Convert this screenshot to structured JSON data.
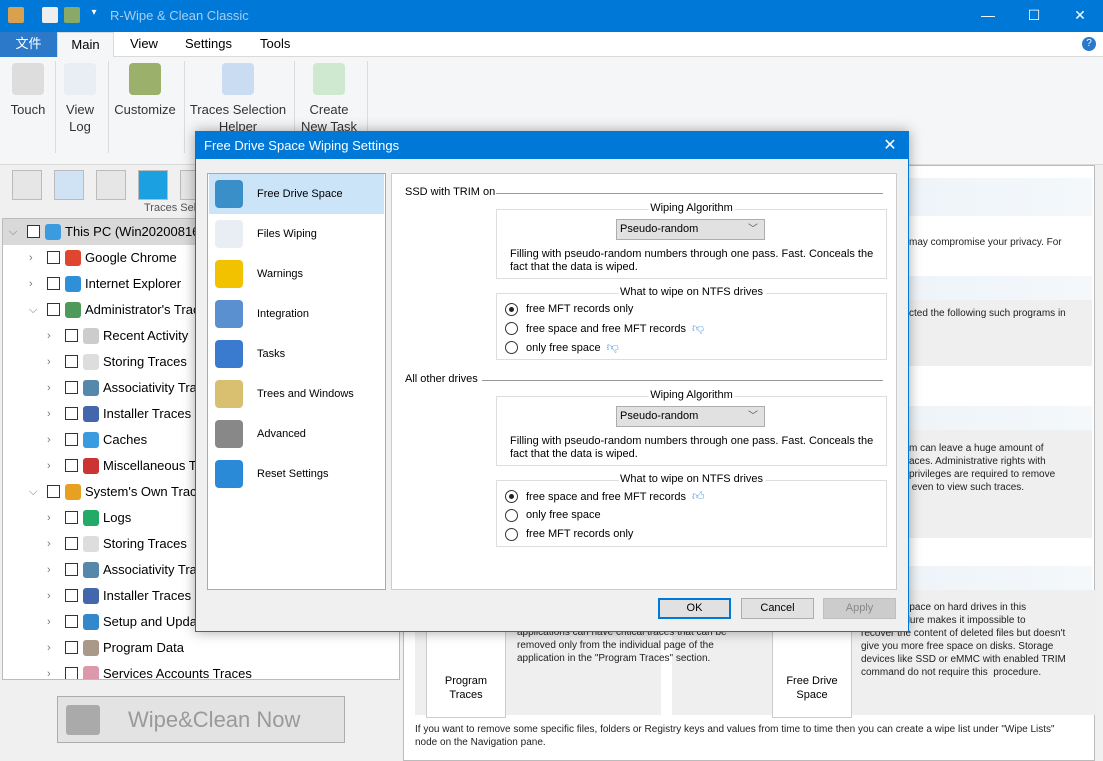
{
  "app": {
    "title": "R-Wipe & Clean Classic",
    "window_controls": [
      "minimize",
      "maximize",
      "close"
    ]
  },
  "menu": {
    "tabs": [
      "文件",
      "Main",
      "View",
      "Settings",
      "Tools"
    ],
    "active": "Main"
  },
  "ribbon": {
    "buttons": [
      {
        "label": "Touch",
        "icon": "touch-icon"
      },
      {
        "label": "View Log",
        "icon": "log-icon"
      },
      {
        "label": "Customize",
        "icon": "tools-icon"
      },
      {
        "label": "Traces Selection Helper",
        "icon": "wand-checklist-icon"
      },
      {
        "label": "Create New Task",
        "icon": "clipboard-add-icon"
      }
    ]
  },
  "toolbar": {
    "group_label": "Traces Sel"
  },
  "tree": [
    {
      "label": "This PC  (Win20200816",
      "level": 0,
      "expanded": true,
      "color": "#3a9be0"
    },
    {
      "label": "Google Chrome",
      "level": 1,
      "color": "#e0452f"
    },
    {
      "label": "Internet  Explorer",
      "level": 1,
      "color": "#2f8fd8"
    },
    {
      "label": "Administrator's Traces",
      "level": 1,
      "expanded": true,
      "color": "#4f9a5a"
    },
    {
      "label": "Recent Activity",
      "level": 2,
      "color": "#ccc"
    },
    {
      "label": "Storing Traces",
      "level": 2,
      "color": "#ddd"
    },
    {
      "label": "Associativity Traces",
      "level": 2,
      "color": "#58a"
    },
    {
      "label": "Installer Traces",
      "level": 2,
      "color": "#46a"
    },
    {
      "label": "Caches",
      "level": 2,
      "color": "#3a9be0"
    },
    {
      "label": "Miscellaneous Traces",
      "level": 2,
      "color": "#c33"
    },
    {
      "label": "System's Own Traces",
      "level": 1,
      "expanded": true,
      "color": "#e8a020"
    },
    {
      "label": "Logs",
      "level": 2,
      "color": "#2a6"
    },
    {
      "label": "Storing Traces",
      "level": 2,
      "color": "#ddd"
    },
    {
      "label": "Associativity Traces",
      "level": 2,
      "color": "#58a"
    },
    {
      "label": "Installer Traces",
      "level": 2,
      "color": "#46a"
    },
    {
      "label": "Setup and Updates",
      "level": 2,
      "color": "#38c"
    },
    {
      "label": "Program Data",
      "level": 2,
      "color": "#a98"
    },
    {
      "label": "Services Accounts Traces",
      "level": 2,
      "color": "#d9a"
    }
  ],
  "wipe_button": "Wipe&Clean Now",
  "main": {
    "s1_text": "may compromise your privacy. For",
    "s2_text": "cted the following such programs in",
    "s3_text": "m can leave a huge amount of\naces. Administrative rights with\nprivileges are required to remove\n even to view such traces.",
    "tile_program": "Program Traces",
    "program_text": "applications can have critical traces that can be removed only from the individual page of the application in the \"Program Traces\" section.",
    "tile_free": "Free Drive Space",
    "free_text": "wipe free space on hard drives in this\nthis procedure makes it impossible to\nrecover the content of deleted files but doesn't\ngive you more free space on disks. Storage\ndevices like SSD or eMMC with enabled TRIM\ncommand do not require this  procedure.",
    "footer": "If you want to remove some specific files, folders or Registry keys and values from time to time then you can create a wipe list under \"Wipe Lists\" node on the Navigation pane."
  },
  "dialog": {
    "title": "Free Drive Space Wiping Settings",
    "nav": [
      {
        "label": "Free Drive Space",
        "icon": "drive-icon",
        "color": "#3a8fc8",
        "selected": true
      },
      {
        "label": "Files Wiping",
        "icon": "file-icon",
        "color": "#e8eef4"
      },
      {
        "label": "Warnings",
        "icon": "warning-icon",
        "color": "#f2c200"
      },
      {
        "label": "Integration",
        "icon": "integration-icon",
        "color": "#5a8fd0"
      },
      {
        "label": "Tasks",
        "icon": "task-icon",
        "color": "#3a7bd0"
      },
      {
        "label": "Trees and Windows",
        "icon": "tree-icon",
        "color": "#d9c070"
      },
      {
        "label": "Advanced",
        "icon": "gear-plus-icon",
        "color": "#888"
      },
      {
        "label": "Reset Settings",
        "icon": "refresh-icon",
        "color": "#2a8ad8"
      }
    ],
    "ssd": {
      "title": "SSD with TRIM on",
      "algo_legend": "Wiping Algorithm",
      "algo": "Pseudo-random",
      "algo_desc": "Filling with pseudo-random numbers through one pass. Fast. Conceals the fact that the data is wiped.",
      "ntfs_legend": "What to wipe on NTFS drives",
      "options": [
        {
          "label": "free MFT records only",
          "checked": true,
          "thumb": ""
        },
        {
          "label": "free space and free MFT records",
          "checked": false,
          "thumb": "thumbs-down"
        },
        {
          "label": "only free space",
          "checked": false,
          "thumb": "thumbs-down"
        }
      ]
    },
    "other": {
      "title": "All other drives",
      "algo_legend": "Wiping Algorithm",
      "algo": "Pseudo-random",
      "algo_desc": "Filling with pseudo-random numbers through one pass. Fast. Conceals the fact that the data is wiped.",
      "ntfs_legend": "What to wipe on NTFS drives",
      "options": [
        {
          "label": "free space and free MFT records",
          "checked": true,
          "thumb": "thumbs-up"
        },
        {
          "label": "only free space",
          "checked": false,
          "thumb": ""
        },
        {
          "label": "free MFT records only",
          "checked": false,
          "thumb": ""
        }
      ]
    },
    "buttons": {
      "ok": "OK",
      "cancel": "Cancel",
      "apply": "Apply"
    }
  }
}
